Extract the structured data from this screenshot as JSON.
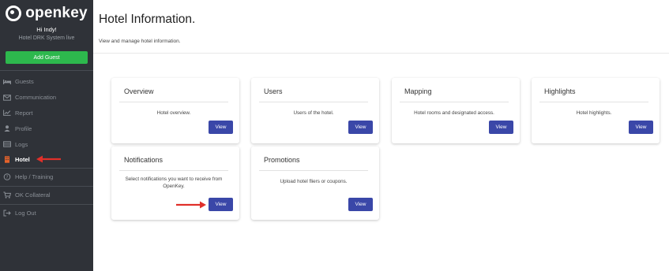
{
  "sidebar": {
    "logo_text": "openkey",
    "greeting": "Hi Indy!",
    "hotel_name": "Hotel DRK System live",
    "add_guest_label": "Add Guest",
    "items": [
      {
        "label": "Guests",
        "icon": "bed-icon"
      },
      {
        "label": "Communication",
        "icon": "envelope-icon"
      },
      {
        "label": "Report",
        "icon": "chart-icon"
      },
      {
        "label": "Profile",
        "icon": "user-icon"
      },
      {
        "label": "Logs",
        "icon": "list-icon"
      },
      {
        "label": "Hotel",
        "icon": "building-icon",
        "active": true
      }
    ],
    "help_label": "Help / Training",
    "collateral_label": "OK Collateral",
    "logout_label": "Log Out"
  },
  "main": {
    "title": "Hotel Information.",
    "subtitle": "View and manage hotel information.",
    "cards": [
      {
        "title": "Overview",
        "description": "Hotel overview.",
        "button": "View"
      },
      {
        "title": "Users",
        "description": "Users of the hotel.",
        "button": "View"
      },
      {
        "title": "Mapping",
        "description": "Hotel rooms and designated access.",
        "button": "View"
      },
      {
        "title": "Highlights",
        "description": "Hotel highlights.",
        "button": "View"
      },
      {
        "title": "Notifications",
        "description": "Select notifications you want to receive from OpenKey.",
        "button": "View"
      },
      {
        "title": "Promotions",
        "description": "Upload hotel fliers or coupons.",
        "button": "View"
      }
    ]
  },
  "colors": {
    "sidebar_bg": "#2f3238",
    "add_guest_green": "#2db84d",
    "view_button_blue": "#3a47a8",
    "annotation_arrow_red": "#e0302a",
    "hotel_icon_orange": "#e8632b"
  }
}
